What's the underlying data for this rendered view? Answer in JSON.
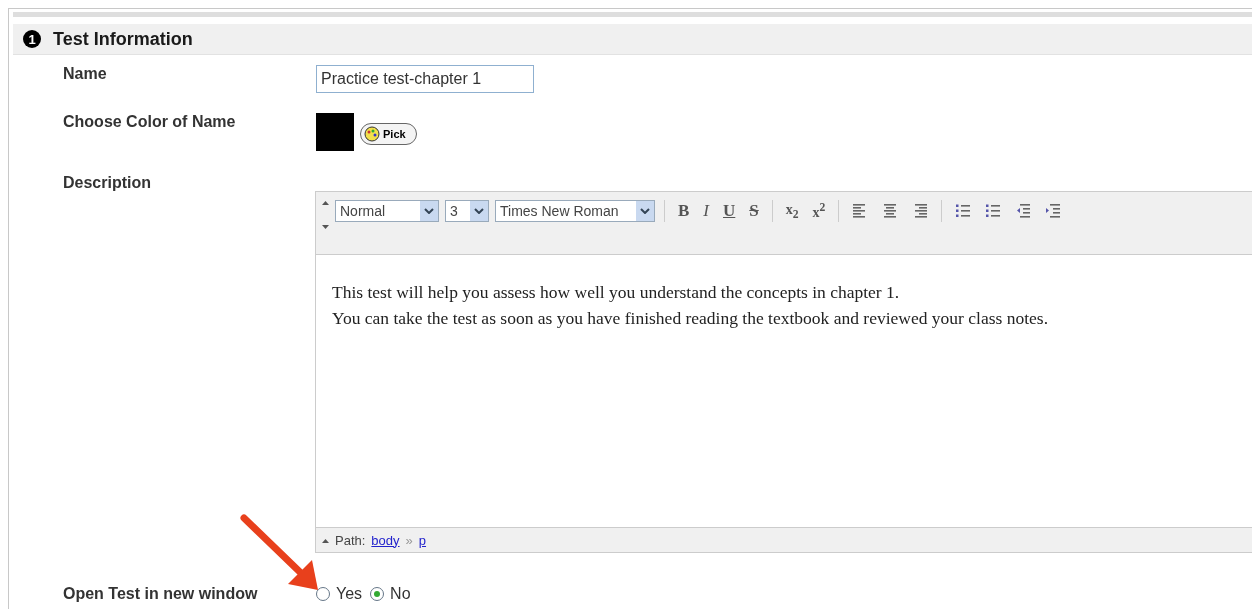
{
  "section": {
    "number": "1",
    "title": "Test Information"
  },
  "name_field": {
    "label": "Name",
    "value": "Practice test-chapter 1"
  },
  "color_field": {
    "label": "Choose Color of Name",
    "color": "#000000",
    "button": "Pick"
  },
  "description": {
    "label": "Description",
    "toolbar": {
      "format": "Normal",
      "size": "3",
      "font": "Times New Roman",
      "buttons": [
        {
          "kind": "bold",
          "label": "B"
        },
        {
          "kind": "italic",
          "label": "I"
        },
        {
          "kind": "underline",
          "label": "U"
        },
        {
          "kind": "strike",
          "label": "S"
        },
        {
          "kind": "separator"
        },
        {
          "kind": "subscript",
          "label": "x$_{2}$"
        },
        {
          "kind": "superscript",
          "label": "x$^{2}$"
        },
        {
          "kind": "separator"
        },
        {
          "kind": "alignleft"
        },
        {
          "kind": "aligncenter"
        },
        {
          "kind": "alignright"
        },
        {
          "kind": "separator"
        },
        {
          "kind": "numbered"
        },
        {
          "kind": "bulleted"
        },
        {
          "kind": "outdent"
        },
        {
          "kind": "indent"
        }
      ]
    },
    "content": [
      "This test will help you assess how well you understand the concepts in chapter 1.",
      "You can take the test as soon as you have finished reading the textbook and reviewed your class notes."
    ],
    "path": {
      "label": "Path:",
      "items": [
        "body",
        "p"
      ],
      "separator": "»"
    }
  },
  "new_window": {
    "label": "Open Test in new window",
    "options": [
      {
        "label": "Yes",
        "selected": false
      },
      {
        "label": "No",
        "selected": true
      }
    ]
  }
}
